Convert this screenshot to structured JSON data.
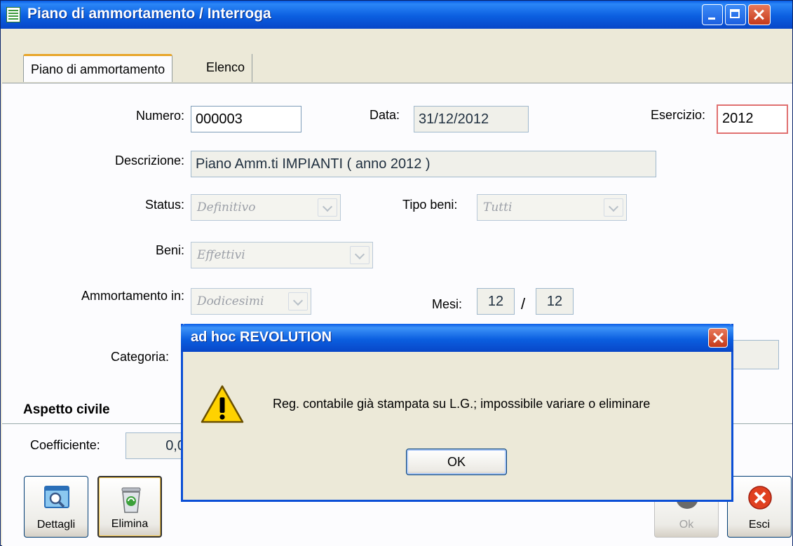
{
  "window": {
    "title": "Piano di ammortamento / Interroga"
  },
  "tabs": [
    {
      "label": "Piano di ammortamento"
    },
    {
      "label": "Elenco"
    }
  ],
  "form": {
    "numero_label": "Numero:",
    "numero": "000003",
    "data_label": "Data:",
    "data": "31/12/2012",
    "esercizio_label": "Esercizio:",
    "esercizio": "2012",
    "descrizione_label": "Descrizione:",
    "descrizione": "Piano Amm.ti  IMPIANTI ( anno 2012 )",
    "status_label": "Status:",
    "status": "Definitivo",
    "tipo_beni_label": "Tipo beni:",
    "tipo_beni": "Tutti",
    "beni_label": "Beni:",
    "beni": "Effettivi",
    "ammortamento_label": "Ammortamento in:",
    "ammortamento": "Dodicesimi",
    "mesi_label": "Mesi:",
    "mesi_from": "12",
    "mesi_sep": "/",
    "mesi_to": "12",
    "categoria_label": "Categoria:",
    "aspetto_civile": "Aspetto civile",
    "coefficiente_label": "Coefficiente:",
    "coefficiente": "0,0"
  },
  "buttons": {
    "dettagli": "Dettagli",
    "elimina": "Elimina",
    "ok": "Ok",
    "esci": "Esci"
  },
  "dialog": {
    "title": "ad hoc REVOLUTION",
    "message": "Reg. contabile già stampata su L.G.; impossibile variare o eliminare",
    "ok": "OK",
    "icon": "warning-icon"
  }
}
